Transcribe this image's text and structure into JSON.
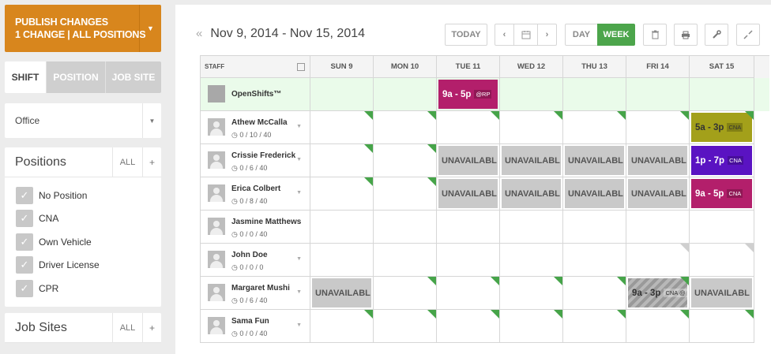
{
  "publish": {
    "line1": "PUBLISH CHANGES",
    "line2": "1 CHANGE | ALL POSITIONS"
  },
  "filter_tabs": [
    "SHIFT",
    "POSITION",
    "JOB SITE"
  ],
  "location_select": {
    "value": "Office"
  },
  "positions_panel": {
    "title": "Positions",
    "all_label": "ALL",
    "add_label": "+",
    "items": [
      "No Position",
      "CNA",
      "Own Vehicle",
      "Driver License",
      "CPR"
    ]
  },
  "jobsites_panel": {
    "title": "Job Sites",
    "all_label": "ALL",
    "add_label": "+"
  },
  "toolbar": {
    "date_range": "Nov 9, 2014 - Nov 15, 2014",
    "today_label": "TODAY",
    "day_label": "DAY",
    "week_label": "WEEK"
  },
  "colors": {
    "publish": "#d8861d",
    "week_active": "#4ca54b",
    "open_row": "#eafbea",
    "shift_magenta": "#b31f6b",
    "shift_olive": "#a3a01a",
    "shift_purple": "#5a13c2"
  },
  "grid": {
    "staff_header": "STAFF",
    "days": [
      "SUN 9",
      "MON 10",
      "TUE 11",
      "WED 12",
      "THU 13",
      "FRI 14",
      "SAT 15"
    ],
    "open_shifts": {
      "label": "OpenShifts™",
      "tue_shift": "9a - 5p",
      "tue_tag": "@RP"
    },
    "staff": [
      {
        "name": "Athew McCalla",
        "hours": "0 / 10 / 40"
      },
      {
        "name": "Crissie Frederick",
        "hours": "0 / 6 / 40"
      },
      {
        "name": "Erica Colbert",
        "hours": "0 / 8 / 40"
      },
      {
        "name": "Jasmine Matthews",
        "hours": "0 / 0 / 40"
      },
      {
        "name": "John Doe",
        "hours": "0 / 0 / 0"
      },
      {
        "name": "Margaret Mushi",
        "hours": "0 / 6 / 40"
      },
      {
        "name": "Sama Fun",
        "hours": "0 / 0 / 40"
      }
    ],
    "unavailable_label": "UNAVAILABL",
    "shifts": {
      "athew_sat": {
        "time": "5a - 3p",
        "tag": "CNA"
      },
      "crissie_sat": {
        "time": "1p - 7p",
        "tag": "CNA"
      },
      "erica_sat": {
        "time": "9a - 5p",
        "tag": "CNA"
      },
      "margaret_fri": {
        "time": "9a - 3p",
        "tag": "CNA @"
      }
    }
  }
}
